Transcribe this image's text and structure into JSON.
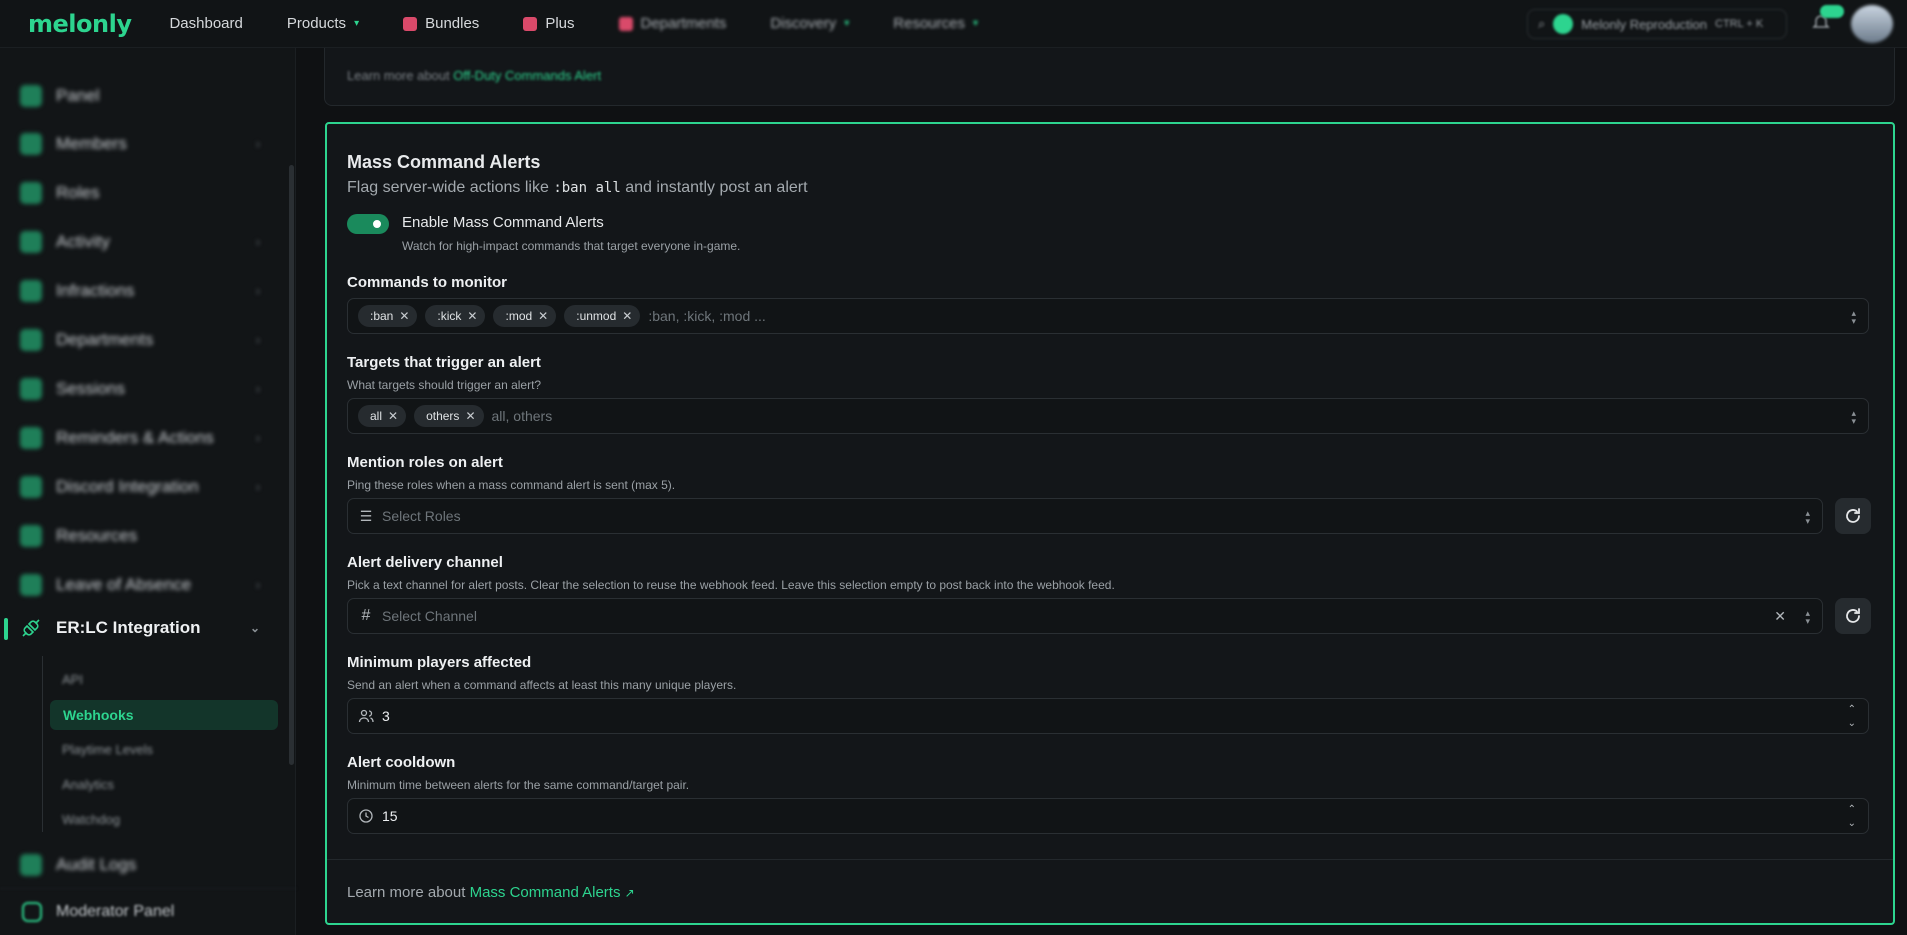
{
  "app": {
    "logo": "melonly",
    "nav": [
      "Dashboard",
      "Products",
      "Bundles",
      "Plus",
      "Departments",
      "Discovery",
      "Resources"
    ],
    "search_placeholder": "Melonly Reproduction",
    "search_shortcut": "CTRL + K"
  },
  "sidebar": {
    "items": [
      "Panel",
      "Members",
      "Roles",
      "Activity",
      "Infractions",
      "Departments",
      "Sessions",
      "Reminders & Actions",
      "Discord Integration",
      "Resources",
      "Leave of Absence"
    ],
    "active": "ER:LC Integration",
    "sub_items": [
      "API",
      "Webhooks",
      "Playtime Levels",
      "Analytics",
      "Watchdog"
    ],
    "active_sub": "Webhooks",
    "after": "Audit Logs",
    "bottom": "Moderator Panel"
  },
  "prev_card": {
    "learn_prefix": "Learn more about",
    "learn_link": "Off-Duty Commands Alert"
  },
  "card": {
    "title": "Mass Command Alerts",
    "subtitle_prefix": "Flag server-wide actions like",
    "subtitle_code": ":ban all",
    "subtitle_suffix": "and instantly post an alert",
    "toggle_label": "Enable Mass Command Alerts",
    "toggle_help": "Watch for high-impact commands that target everyone in-game.",
    "toggle_on": true,
    "commands": {
      "label": "Commands to monitor",
      "chips": [
        ":ban",
        ":kick",
        ":mod",
        ":unmod"
      ],
      "placeholder": ":ban, :kick, :mod ..."
    },
    "targets": {
      "label": "Targets that trigger an alert",
      "help": "What targets should trigger an alert?",
      "chips": [
        "all",
        "others"
      ],
      "placeholder": "all, others"
    },
    "mention": {
      "label": "Mention roles on alert",
      "help": "Ping these roles when a mass command alert is sent (max 5).",
      "placeholder": "Select Roles"
    },
    "channel": {
      "label": "Alert delivery channel",
      "help": "Pick a text channel for alert posts. Clear the selection to reuse the webhook feed. Leave this selection empty to post back into the webhook feed.",
      "placeholder": "Select Channel"
    },
    "min_players": {
      "label": "Minimum players affected",
      "help": "Send an alert when a command affects at least this many unique players.",
      "value": "3"
    },
    "cooldown": {
      "label": "Alert cooldown",
      "help": "Minimum time between alerts for the same command/target pair.",
      "value": "15"
    },
    "footer_prefix": "Learn more about",
    "footer_link": "Mass Command Alerts"
  },
  "colors": {
    "accent": "#2dd48f",
    "bg": "#0f1113",
    "card": "#131619"
  }
}
